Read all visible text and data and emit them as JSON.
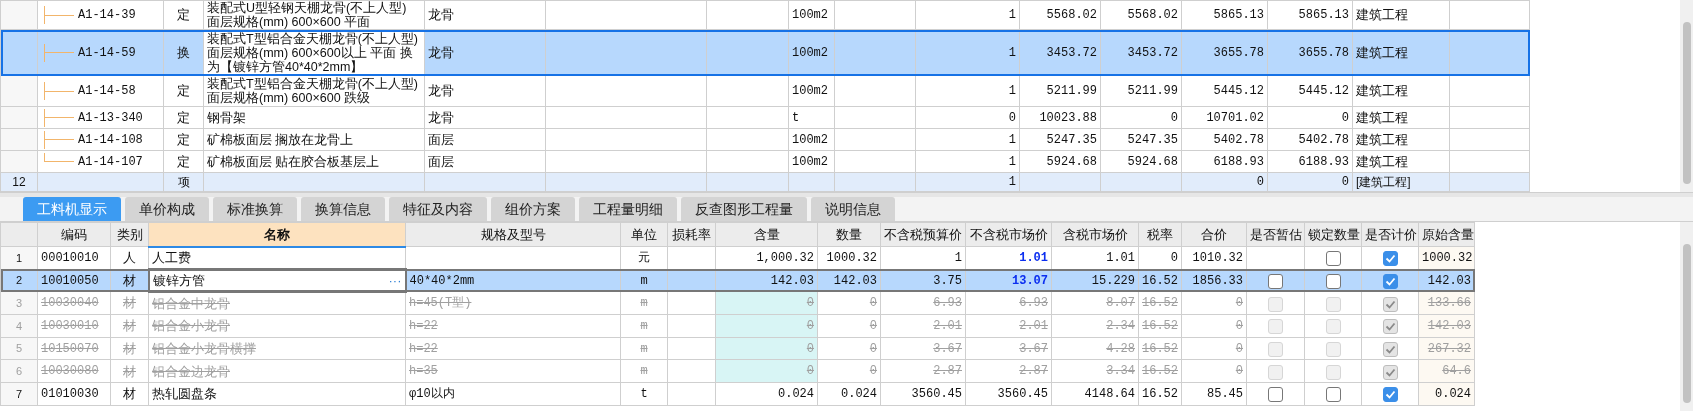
{
  "top_table": {
    "rows": [
      {
        "kind": "quota",
        "selected": false,
        "code": "A1-14-39",
        "type": "定",
        "name": "装配式U型轻钢天棚龙骨(不上人型) 面层规格(mm) 600×600 平面",
        "column_4": "龙骨",
        "unit": "100m2",
        "quantity": "1",
        "column_10": "5568.02",
        "column_11": "5568.02",
        "column_12": "5865.13",
        "column_13": "5865.13",
        "column_14": "建筑工程"
      },
      {
        "kind": "quota",
        "selected": true,
        "code": "A1-14-59",
        "type": "换",
        "name": "装配式T型铝合金天棚龙骨(不上人型) 面层规格(mm) 600×600以上 平面 换为【镀锌方管40*40*2mm】",
        "column_4": "龙骨",
        "unit": "100m2",
        "quantity": "1",
        "column_10": "3453.72",
        "column_11": "3453.72",
        "column_12": "3655.78",
        "column_13": "3655.78",
        "column_14": "建筑工程"
      },
      {
        "kind": "quota",
        "selected": false,
        "code": "A1-14-58",
        "type": "定",
        "name": "装配式T型铝合金天棚龙骨(不上人型) 面层规格(mm) 600×600 跌级",
        "column_4": "龙骨",
        "unit": "100m2",
        "quantity": "1",
        "column_10": "5211.99",
        "column_11": "5211.99",
        "column_12": "5445.12",
        "column_13": "5445.12",
        "column_14": "建筑工程"
      },
      {
        "kind": "quota",
        "selected": false,
        "code": "A1-13-340",
        "type": "定",
        "name": "钢骨架",
        "column_4": "龙骨",
        "unit": "t",
        "quantity": "0",
        "column_10": "10023.88",
        "column_11": "0",
        "column_12": "10701.02",
        "column_13": "0",
        "column_14": "建筑工程"
      },
      {
        "kind": "quota",
        "selected": false,
        "code": "A1-14-108",
        "type": "定",
        "name": "矿棉板面层 搁放在龙骨上",
        "column_4": "面层",
        "unit": "100m2",
        "quantity": "1",
        "column_10": "5247.35",
        "column_11": "5247.35",
        "column_12": "5402.78",
        "column_13": "5402.78",
        "column_14": "建筑工程"
      },
      {
        "kind": "quota",
        "selected": false,
        "code": "A1-14-107",
        "type": "定",
        "name": "矿棉板面层 贴在胶合板基层上",
        "column_4": "面层",
        "unit": "100m2",
        "quantity": "1",
        "column_10": "5924.68",
        "column_11": "5924.68",
        "column_12": "6188.93",
        "column_13": "6188.93",
        "column_14": "建筑工程"
      },
      {
        "kind": "section",
        "selected": false,
        "row_number": "12",
        "type": "项",
        "quantity": "1",
        "column_12": "0",
        "column_13": "0",
        "column_14": "[建筑工程]"
      }
    ]
  },
  "tabs": [
    {
      "label": "工料机显示",
      "selected": true
    },
    {
      "label": "单价构成",
      "selected": false
    },
    {
      "label": "标准换算",
      "selected": false
    },
    {
      "label": "换算信息",
      "selected": false
    },
    {
      "label": "特征及内容",
      "selected": false
    },
    {
      "label": "组价方案",
      "selected": false
    },
    {
      "label": "工程量明细",
      "selected": false
    },
    {
      "label": "反查图形工程量",
      "selected": false
    },
    {
      "label": "说明信息",
      "selected": false
    }
  ],
  "resource_table": {
    "columns": [
      {
        "label": "编码",
        "selected": false
      },
      {
        "label": "类别",
        "selected": false
      },
      {
        "label": "名称",
        "selected": true
      },
      {
        "label": "规格及型号",
        "selected": false
      },
      {
        "label": "单位",
        "selected": false
      },
      {
        "label": "损耗率",
        "selected": false
      },
      {
        "label": "含量",
        "selected": false
      },
      {
        "label": "数量",
        "selected": false
      },
      {
        "label": "不含税预算价",
        "selected": false
      },
      {
        "label": "不含税市场价",
        "selected": false
      },
      {
        "label": "含税市场价",
        "selected": false
      },
      {
        "label": "税率",
        "selected": false
      },
      {
        "label": "合价",
        "selected": false
      },
      {
        "label": "是否暂估",
        "selected": false
      },
      {
        "label": "锁定数量",
        "selected": false
      },
      {
        "label": "是否计价",
        "selected": false
      },
      {
        "label": "原始含量",
        "selected": false
      }
    ],
    "rows": [
      {
        "row_number": "1",
        "selected": false,
        "struck": false,
        "code": "00010010",
        "category": "人",
        "name": "人工费",
        "unit": "元",
        "content": "1,000.32",
        "quantity": "1000.32",
        "budget_price": "1",
        "market_price": "1.01",
        "market_price_changed": true,
        "market_price_tax": "1.01",
        "tax_rate": "0",
        "total": "1010.32",
        "locked": false,
        "priced": true,
        "original_content": "1000.32"
      },
      {
        "row_number": "2",
        "selected": true,
        "struck": false,
        "code": "10010050",
        "category": "材",
        "name": "镀锌方管",
        "name_button": "···",
        "spec": "40*40*2mm",
        "unit": "m",
        "content": "142.03",
        "quantity": "142.03",
        "budget_price": "3.75",
        "market_price": "13.07",
        "market_price_changed": true,
        "market_price_tax": "15.229",
        "tax_rate": "16.52",
        "total": "1856.33",
        "provisional": false,
        "locked": false,
        "priced": true,
        "original_content": "142.03"
      },
      {
        "row_number": "3",
        "selected": false,
        "struck": true,
        "code": "10030040",
        "category": "材",
        "name": "铝合金中龙骨",
        "spec": "h=45(T型)",
        "unit": "m",
        "content": "0",
        "quantity": "0",
        "budget_price": "6.93",
        "market_price": "6.93",
        "market_price_changed": false,
        "market_price_tax": "8.07",
        "tax_rate": "16.52",
        "total": "0",
        "provisional": false,
        "locked": false,
        "priced": true,
        "original_content": "133.66"
      },
      {
        "row_number": "4",
        "selected": false,
        "struck": true,
        "code": "10030010",
        "category": "材",
        "name": "铝合金小龙骨",
        "spec": "h=22",
        "unit": "m",
        "content": "0",
        "quantity": "0",
        "budget_price": "2.01",
        "market_price": "2.01",
        "market_price_changed": false,
        "market_price_tax": "2.34",
        "tax_rate": "16.52",
        "total": "0",
        "provisional": false,
        "locked": false,
        "priced": true,
        "original_content": "142.03"
      },
      {
        "row_number": "5",
        "selected": false,
        "struck": true,
        "code": "10150070",
        "category": "材",
        "name": "铝合金小龙骨横撑",
        "spec": "h=22",
        "unit": "m",
        "content": "0",
        "quantity": "0",
        "budget_price": "3.67",
        "market_price": "3.67",
        "market_price_changed": false,
        "market_price_tax": "4.28",
        "tax_rate": "16.52",
        "total": "0",
        "provisional": false,
        "locked": false,
        "priced": true,
        "original_content": "267.32"
      },
      {
        "row_number": "6",
        "selected": false,
        "struck": true,
        "code": "10030080",
        "category": "材",
        "name": "铝合金边龙骨",
        "spec": "h=35",
        "unit": "m",
        "content": "0",
        "quantity": "0",
        "budget_price": "2.87",
        "market_price": "2.87",
        "market_price_changed": false,
        "market_price_tax": "3.34",
        "tax_rate": "16.52",
        "total": "0",
        "provisional": false,
        "locked": false,
        "priced": true,
        "original_content": "64.6"
      },
      {
        "row_number": "7",
        "selected": false,
        "struck": false,
        "code": "01010030",
        "category": "材",
        "name": "热轧圆盘条",
        "spec": "φ10以内",
        "unit": "t",
        "content": "0.024",
        "quantity": "0.024",
        "budget_price": "3560.45",
        "market_price": "3560.45",
        "market_price_changed": false,
        "market_price_tax": "4148.64",
        "tax_rate": "16.52",
        "total": "85.45",
        "provisional": false,
        "locked": false,
        "priced": true,
        "original_content": "0.024"
      }
    ]
  }
}
